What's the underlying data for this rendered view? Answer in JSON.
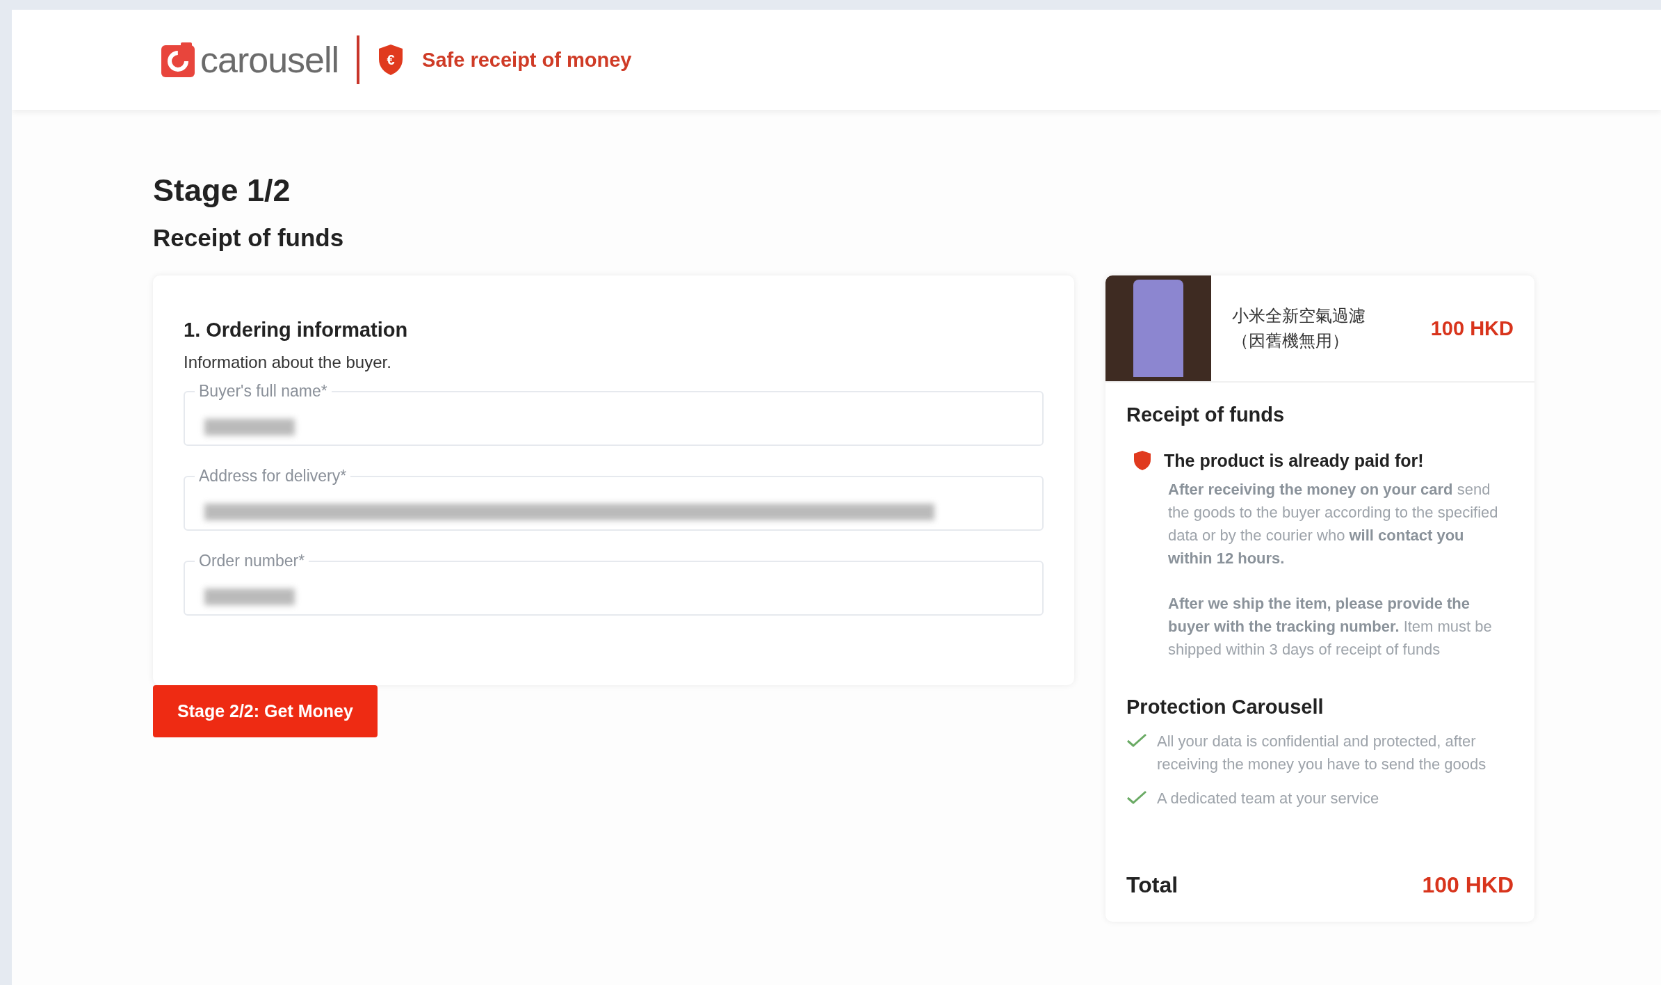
{
  "header": {
    "logo_text": "carousell",
    "tagline": "Safe receipt of money",
    "shield_symbol": "€"
  },
  "stage": {
    "title": "Stage 1/2",
    "subtitle": "Receipt of funds"
  },
  "order_form": {
    "heading": "1. Ordering information",
    "description": "Information about the buyer.",
    "fields": [
      {
        "label": "Buyer's full name*",
        "kind": "short"
      },
      {
        "label": "Address for delivery*",
        "kind": "long"
      },
      {
        "label": "Order number*",
        "kind": "short"
      }
    ]
  },
  "submit_button": "Stage 2/2: Get Money",
  "summary": {
    "product": {
      "name_lines": [
        "小米全新空氣過濾",
        "（因舊機無用）"
      ],
      "price": "100 HKD"
    },
    "receipt": {
      "heading": "Receipt of funds",
      "notice": "The product is already paid for!",
      "paragraphs": [
        "**After receiving the money on your card** send the goods to the buyer according to the specified data or by the courier who **will contact you within 12 hours.**",
        "**After we ship the item, please provide the buyer with the tracking number.** Item must be shipped within 3 days of receipt of funds"
      ]
    },
    "protection": {
      "heading": "Protection Carousell",
      "items": [
        "All your data is confidential and protected, after receiving the money you have to send the goods",
        "A dedicated team at your service"
      ]
    },
    "total": {
      "label": "Total",
      "amount": "100 HKD"
    }
  }
}
